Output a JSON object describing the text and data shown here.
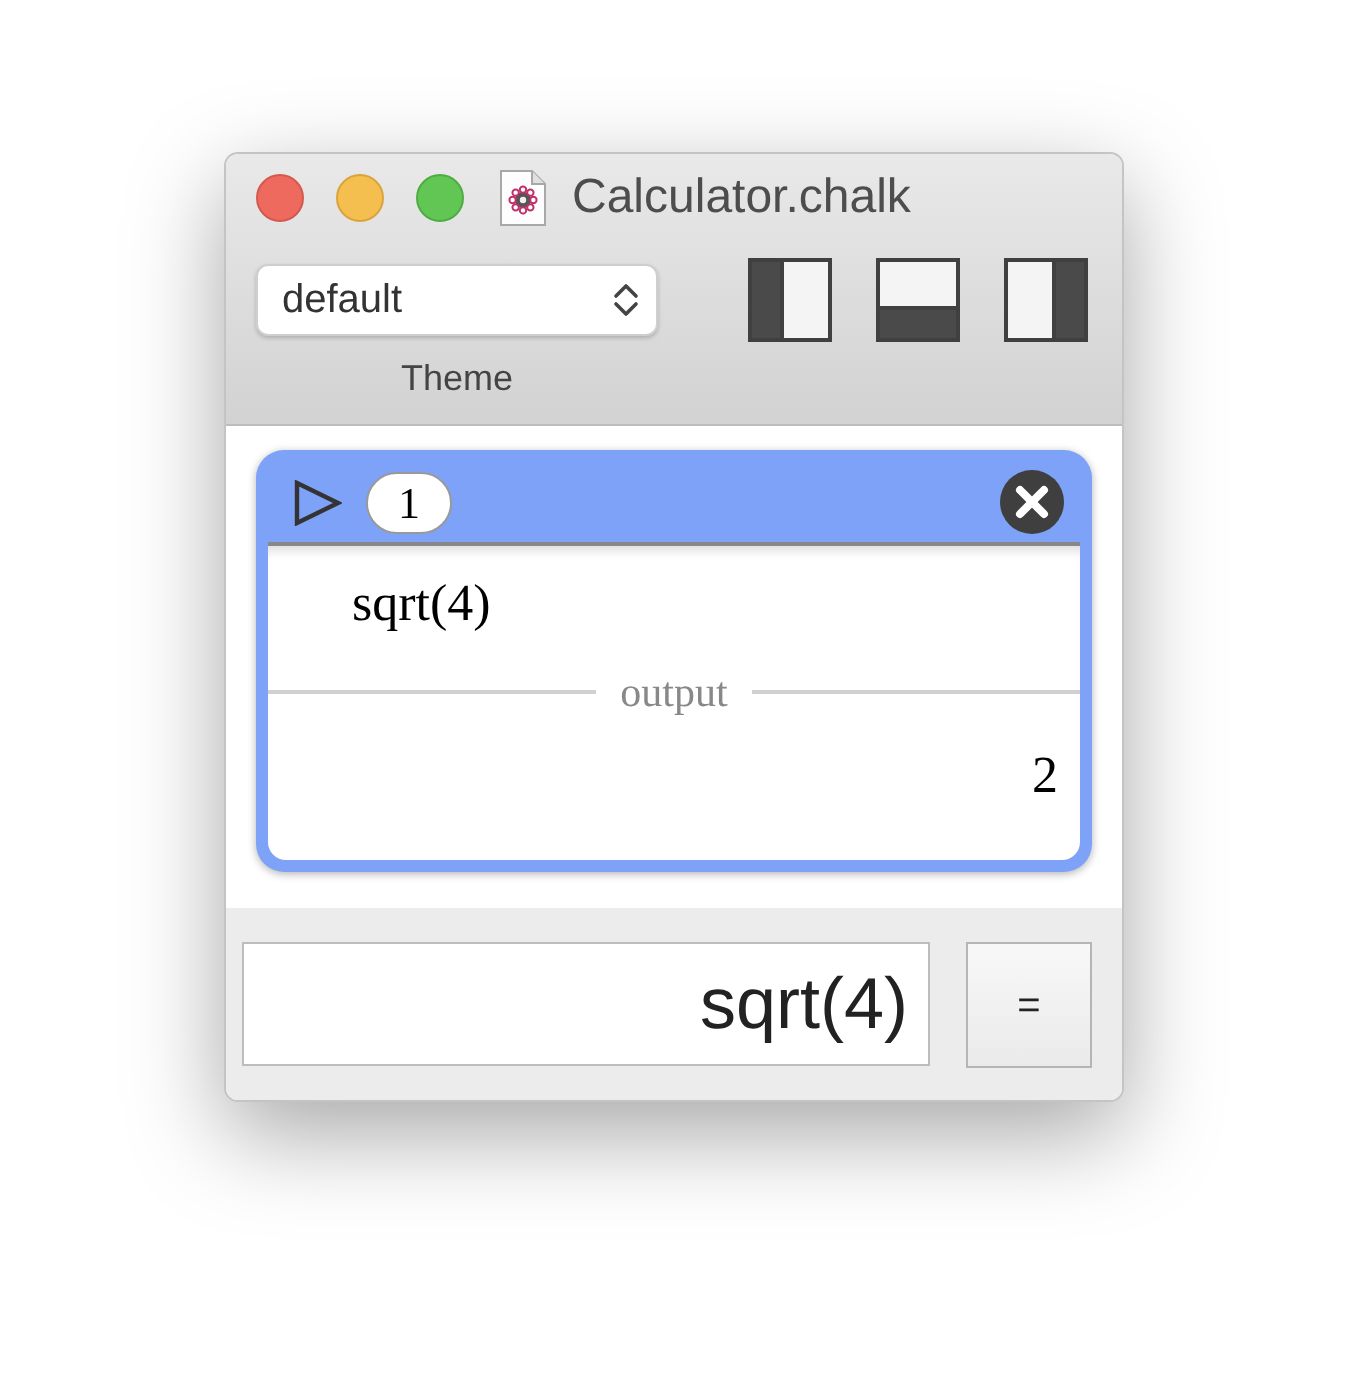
{
  "window": {
    "title": "Calculator.chalk"
  },
  "toolbar": {
    "theme_popup": {
      "value": "default"
    },
    "theme_label": "Theme",
    "layout_buttons": [
      {
        "kind": "left"
      },
      {
        "kind": "bottom"
      },
      {
        "kind": "right"
      }
    ]
  },
  "entries": [
    {
      "number": "1",
      "input": "sqrt(4)",
      "output_label": "output",
      "output": "2"
    }
  ],
  "input_bar": {
    "value": "sqrt(4)",
    "evaluate_button": {
      "label": "="
    }
  }
}
